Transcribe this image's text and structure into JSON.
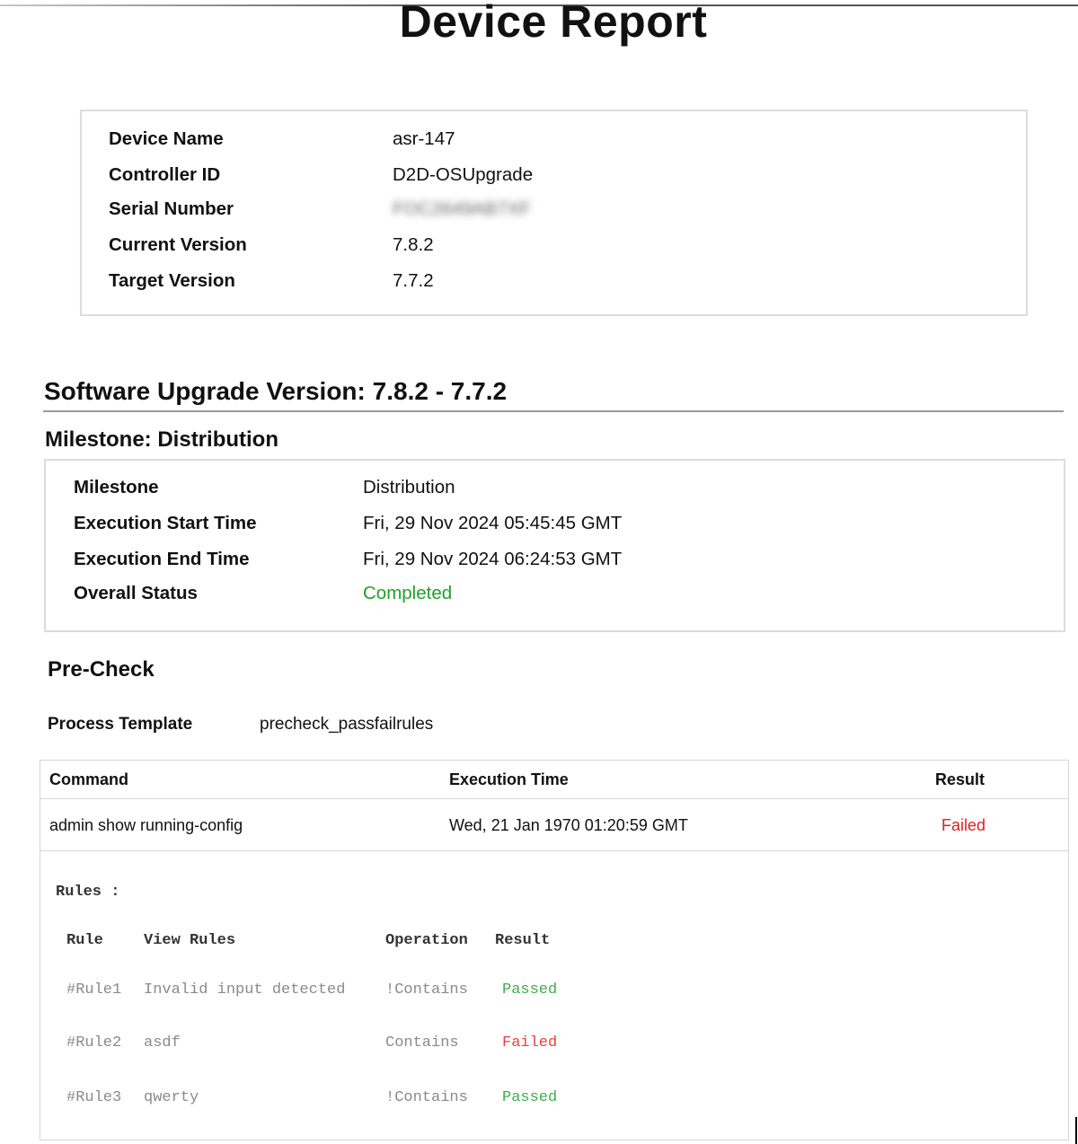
{
  "report_title": "Device Report",
  "device_info": [
    {
      "label": "Device Name",
      "value": "asr-147"
    },
    {
      "label": "Controller ID",
      "value": "D2D-OSUpgrade"
    },
    {
      "label": "Serial Number",
      "value": "FOC2649AB7XF"
    },
    {
      "label": "Current Version",
      "value": "7.8.2"
    },
    {
      "label": "Target Version",
      "value": "7.7.2"
    }
  ],
  "upgrade": {
    "title": "Software Upgrade Version: 7.8.2 - 7.7.2",
    "milestone_heading": "Milestone: Distribution",
    "milestone_details": [
      {
        "label": "Milestone",
        "value": "Distribution"
      },
      {
        "label": "Execution Start Time",
        "value": "Fri, 29 Nov 2024 05:45:45 GMT"
      },
      {
        "label": "Execution End Time",
        "value": "Fri, 29 Nov 2024 06:24:53 GMT"
      },
      {
        "label": "Overall Status",
        "value": "Completed"
      }
    ],
    "status_color": "#22a02a"
  },
  "precheck": {
    "heading": "Pre-Check",
    "process_template_label": "Process Template",
    "process_template_value": "precheck_passfailrules",
    "columns": [
      "Command",
      "Execution Time",
      "Result"
    ],
    "command_row": {
      "command": "admin show running-config",
      "execution_time": "Wed, 21 Jan 1970 01:20:59 GMT",
      "result": "Failed"
    },
    "failed_color": "#e02020",
    "rules_title": "Rules :",
    "rule_columns": [
      "Rule",
      "View Rules",
      "Operation",
      "Result"
    ],
    "rules": [
      {
        "rule": "#Rule1",
        "view": "Invalid input detected",
        "operation": "!Contains",
        "result": "Passed"
      },
      {
        "rule": "#Rule2",
        "view": "asdf",
        "operation": "Contains",
        "result": "Failed"
      },
      {
        "rule": "#Rule3",
        "view": "qwerty",
        "operation": "!Contains",
        "result": "Passed"
      }
    ]
  }
}
